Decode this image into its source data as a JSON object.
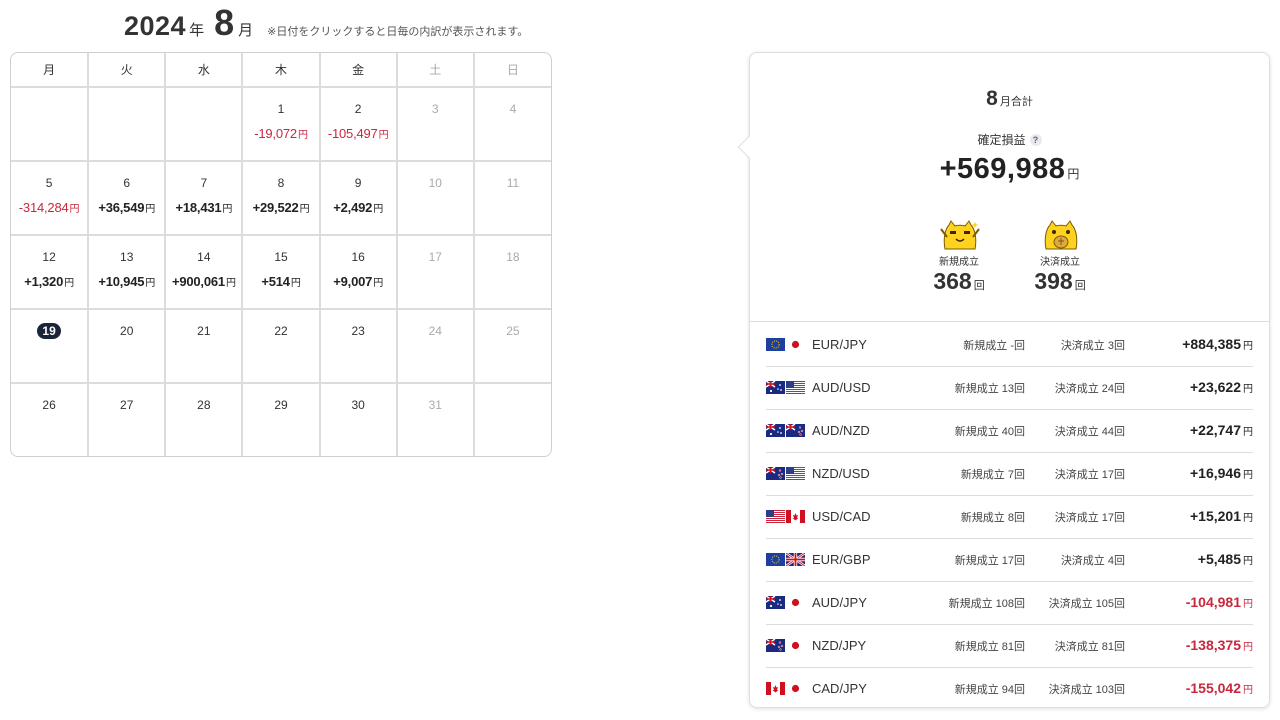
{
  "calendar": {
    "year": "2024",
    "year_unit": "年",
    "month": "8",
    "month_unit": "月",
    "note": "※日付をクリックすると日毎の内訳が表示されます。",
    "weekdays": [
      "月",
      "火",
      "水",
      "木",
      "金",
      "土",
      "日"
    ],
    "currency_unit": "円",
    "weeks": [
      [
        {
          "day": "",
          "pl": ""
        },
        {
          "day": "",
          "pl": ""
        },
        {
          "day": "",
          "pl": ""
        },
        {
          "day": "1",
          "pl": "-19,072",
          "sign": "neg"
        },
        {
          "day": "2",
          "pl": "-105,497",
          "sign": "neg"
        },
        {
          "day": "3",
          "pl": "",
          "weekend": true
        },
        {
          "day": "4",
          "pl": "",
          "weekend": true
        }
      ],
      [
        {
          "day": "5",
          "pl": "-314,284",
          "sign": "neg"
        },
        {
          "day": "6",
          "pl": "+36,549",
          "sign": "pos"
        },
        {
          "day": "7",
          "pl": "+18,431",
          "sign": "pos"
        },
        {
          "day": "8",
          "pl": "+29,522",
          "sign": "pos"
        },
        {
          "day": "9",
          "pl": "+2,492",
          "sign": "pos"
        },
        {
          "day": "10",
          "pl": "",
          "weekend": true
        },
        {
          "day": "11",
          "pl": "",
          "weekend": true
        }
      ],
      [
        {
          "day": "12",
          "pl": "+1,320",
          "sign": "pos"
        },
        {
          "day": "13",
          "pl": "+10,945",
          "sign": "pos"
        },
        {
          "day": "14",
          "pl": "+900,061",
          "sign": "pos"
        },
        {
          "day": "15",
          "pl": "+514",
          "sign": "pos"
        },
        {
          "day": "16",
          "pl": "+9,007",
          "sign": "pos"
        },
        {
          "day": "17",
          "pl": "",
          "weekend": true
        },
        {
          "day": "18",
          "pl": "",
          "weekend": true
        }
      ],
      [
        {
          "day": "19",
          "pl": "",
          "today": true
        },
        {
          "day": "20",
          "pl": ""
        },
        {
          "day": "21",
          "pl": ""
        },
        {
          "day": "22",
          "pl": ""
        },
        {
          "day": "23",
          "pl": ""
        },
        {
          "day": "24",
          "pl": "",
          "weekend": true
        },
        {
          "day": "25",
          "pl": "",
          "weekend": true
        }
      ],
      [
        {
          "day": "26",
          "pl": ""
        },
        {
          "day": "27",
          "pl": ""
        },
        {
          "day": "28",
          "pl": ""
        },
        {
          "day": "29",
          "pl": ""
        },
        {
          "day": "30",
          "pl": ""
        },
        {
          "day": "31",
          "pl": "",
          "weekend": true
        },
        {
          "day": "",
          "pl": ""
        }
      ]
    ]
  },
  "summary": {
    "month": "8",
    "title_suffix": "月合計",
    "profit_label": "確定損益",
    "help_glyph": "?",
    "profit_value": "+569,988",
    "unit": "円",
    "new_label": "新規成立",
    "new_count": "368",
    "close_label": "決済成立",
    "close_count": "398",
    "count_unit": "回"
  },
  "pairs": [
    {
      "name": "EUR/JPY",
      "flags": [
        "eu",
        "jp"
      ],
      "open": "新規成立 -回",
      "close": "決済成立 3回",
      "pl": "+884,385",
      "sign": "pos"
    },
    {
      "name": "AUD/USD",
      "flags": [
        "au",
        "us"
      ],
      "open": "新規成立 13回",
      "close": "決済成立 24回",
      "pl": "+23,622",
      "sign": "pos"
    },
    {
      "name": "AUD/NZD",
      "flags": [
        "au",
        "nz"
      ],
      "open": "新規成立 40回",
      "close": "決済成立 44回",
      "pl": "+22,747",
      "sign": "pos"
    },
    {
      "name": "NZD/USD",
      "flags": [
        "nz",
        "us"
      ],
      "open": "新規成立 7回",
      "close": "決済成立 17回",
      "pl": "+16,946",
      "sign": "pos"
    },
    {
      "name": "USD/CAD",
      "flags": [
        "us",
        "ca"
      ],
      "open": "新規成立 8回",
      "close": "決済成立 17回",
      "pl": "+15,201",
      "sign": "pos"
    },
    {
      "name": "EUR/GBP",
      "flags": [
        "eu",
        "gb"
      ],
      "open": "新規成立 17回",
      "close": "決済成立 4回",
      "pl": "+5,485",
      "sign": "pos"
    },
    {
      "name": "AUD/JPY",
      "flags": [
        "au",
        "jp"
      ],
      "open": "新規成立 108回",
      "close": "決済成立 105回",
      "pl": "-104,981",
      "sign": "neg"
    },
    {
      "name": "NZD/JPY",
      "flags": [
        "nz",
        "jp"
      ],
      "open": "新規成立 81回",
      "close": "決済成立 81回",
      "pl": "-138,375",
      "sign": "neg"
    },
    {
      "name": "CAD/JPY",
      "flags": [
        "ca",
        "jp"
      ],
      "open": "新規成立 94回",
      "close": "決済成立 103回",
      "pl": "-155,042",
      "sign": "neg"
    }
  ],
  "colors": {
    "positive": "#222222",
    "negative": "#c8273d",
    "today_badge": "#1b2439",
    "mascot": "#ffd21f"
  },
  "icons": {
    "mascot_open": "tiger-mascot-cheer-icon",
    "mascot_close": "tiger-mascot-coin-icon",
    "help": "question-mark-icon"
  }
}
